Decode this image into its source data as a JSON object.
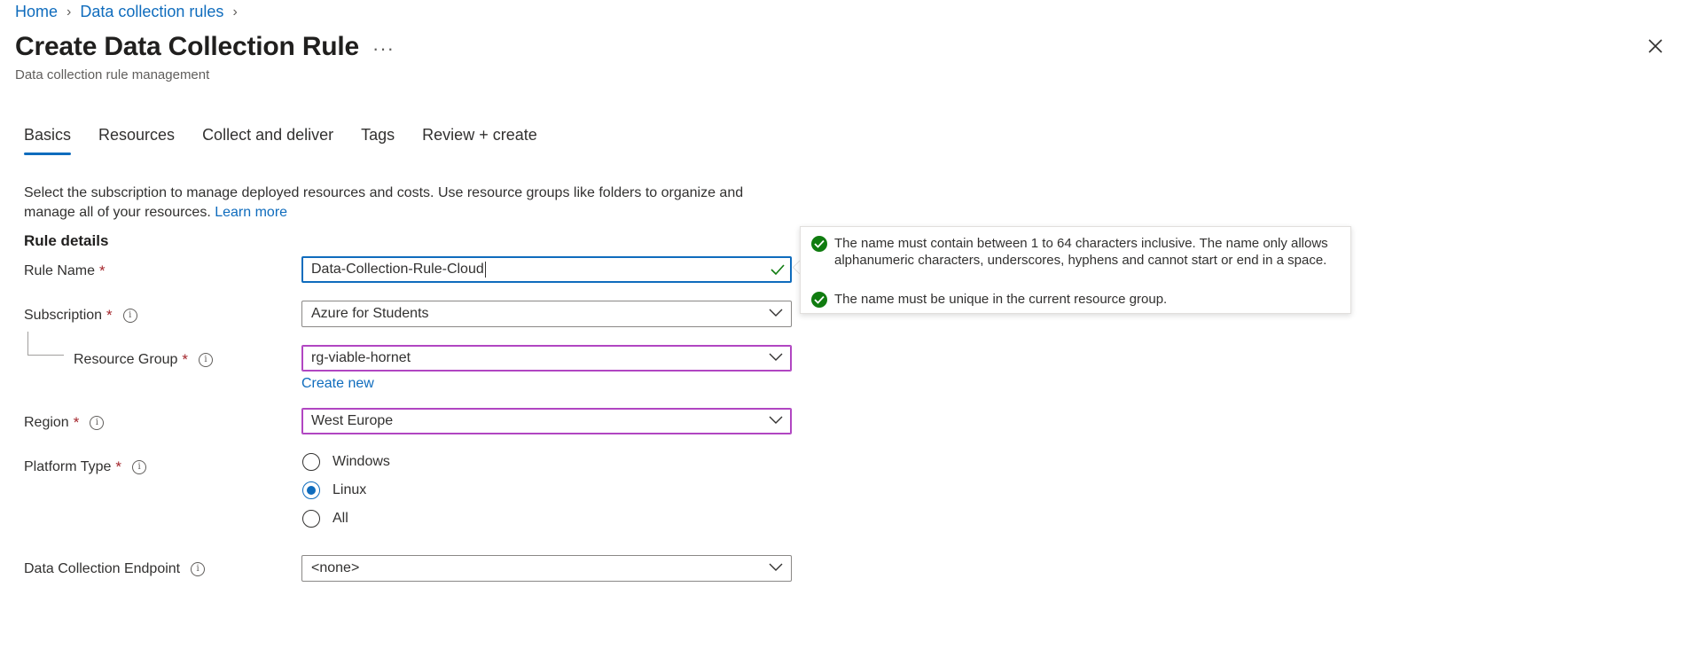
{
  "breadcrumb": {
    "home": "Home",
    "parent": "Data collection rules"
  },
  "header": {
    "title": "Create Data Collection Rule",
    "more": "···",
    "subtitle": "Data collection rule management"
  },
  "tabs": [
    {
      "label": "Basics",
      "active": true
    },
    {
      "label": "Resources",
      "active": false
    },
    {
      "label": "Collect and deliver",
      "active": false
    },
    {
      "label": "Tags",
      "active": false
    },
    {
      "label": "Review + create",
      "active": false
    }
  ],
  "description": {
    "text": "Select the subscription to manage deployed resources and costs. Use resource groups like folders to organize and manage all of your resources.",
    "learn_more": "Learn more"
  },
  "section_title": "Rule details",
  "form": {
    "rule_name": {
      "label": "Rule Name",
      "required": "*",
      "value": "Data-Collection-Rule-Cloud"
    },
    "subscription": {
      "label": "Subscription",
      "required": "*",
      "value": "Azure for Students"
    },
    "resource_group": {
      "label": "Resource Group",
      "required": "*",
      "value": "rg-viable-hornet",
      "create_new": "Create new"
    },
    "region": {
      "label": "Region",
      "required": "*",
      "value": "West Europe"
    },
    "platform_type": {
      "label": "Platform Type",
      "required": "*",
      "options": [
        "Windows",
        "Linux",
        "All"
      ],
      "selected": "Linux"
    },
    "endpoint": {
      "label": "Data Collection Endpoint",
      "value": "<none>"
    }
  },
  "validation": {
    "rules": [
      "The name must contain between 1 to 64 characters inclusive. The name only allows alphanumeric characters, underscores, hyphens and cannot start or end in a space.",
      "The name must be unique in the current resource group."
    ]
  },
  "icons": {
    "close": "close-icon",
    "info": "info-icon",
    "chevron": "chevron-down-icon",
    "check": "checkmark-icon",
    "success": "success-circle-icon"
  },
  "colors": {
    "accent": "#0f6cbd",
    "required": "#a4262c",
    "success": "#107c10",
    "validation_border": "#b146c2"
  }
}
